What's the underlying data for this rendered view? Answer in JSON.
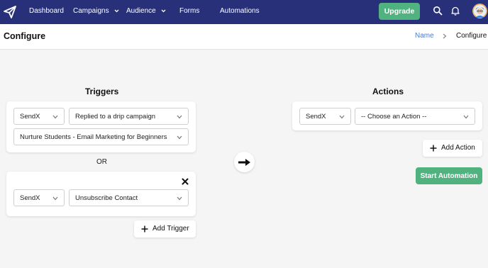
{
  "nav": {
    "items": [
      {
        "label": "Dashboard",
        "has_dropdown": false
      },
      {
        "label": "Campaigns",
        "has_dropdown": true
      },
      {
        "label": "Audience",
        "has_dropdown": true
      },
      {
        "label": "Forms",
        "has_dropdown": false
      },
      {
        "label": "Automations",
        "has_dropdown": false
      }
    ],
    "upgrade_label": "Upgrade",
    "icons": [
      "logo-paper-plane-icon",
      "search-icon",
      "bell-icon",
      "user-avatar"
    ],
    "colors": {
      "background": "#28307a",
      "upgrade": "#50b37f"
    }
  },
  "header": {
    "title": "Configure",
    "breadcrumb": {
      "link": "Name",
      "current": "Configure"
    }
  },
  "triggers": {
    "title": "Triggers",
    "group1": {
      "app": "SendX",
      "event": "Replied to a drip campaign",
      "campaign": "Nurture Students - Email Marketing for Beginners"
    },
    "or_label": "OR",
    "group2": {
      "app": "SendX",
      "event": "Unsubscribe Contact"
    },
    "add_trigger_label": "Add Trigger"
  },
  "actions": {
    "title": "Actions",
    "app": "SendX",
    "action": "-- Choose an Action --",
    "add_action_label": "Add Action",
    "start_label": "Start Automation"
  },
  "colors": {
    "accent_green": "#50b37f",
    "link_blue": "#4a7bd3",
    "page_bg": "#f5f5f5"
  }
}
